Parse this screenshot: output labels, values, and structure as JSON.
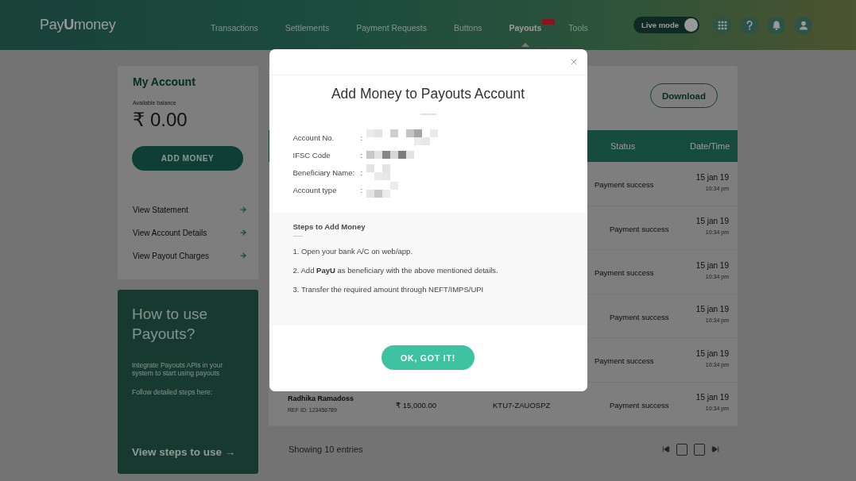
{
  "header": {
    "logo": "Pay**U**money",
    "nav": [
      {
        "label": "Transactions",
        "selected": false,
        "badge": false
      },
      {
        "label": "Settlements",
        "selected": false,
        "badge": false
      },
      {
        "label": "Payment Requests",
        "selected": false,
        "badge": false
      },
      {
        "label": "Buttons",
        "selected": false,
        "badge": false
      },
      {
        "label": "Payouts",
        "selected": true,
        "badge": true
      },
      {
        "label": "Tools",
        "selected": false,
        "badge": false
      }
    ],
    "live_mode": {
      "label": "Live mode",
      "on": true
    }
  },
  "account_card": {
    "title": "My Account",
    "balance_label": "Available balance",
    "balance": "₹ 0.00",
    "button": "ADD MONEY",
    "links": [
      "View Statement",
      "View Account Details",
      "View Payout Charges"
    ]
  },
  "help_card": {
    "title": "How to use Payouts?",
    "paragraphs": [
      "Integrate Payouts APIs in your system to start using payouts",
      "Follow detailed steps here:"
    ],
    "link": "View steps to use →"
  },
  "transactions": {
    "download": "Download",
    "columns": [
      {
        "label": "Status"
      },
      {
        "label": "Date/Time"
      }
    ],
    "rows": [
      {
        "status": "Payment success",
        "date": "15 jan 19",
        "time": "10:34 pm"
      },
      {
        "status": "Payment success",
        "date": "15 jan 19",
        "time": "10:34 pm"
      },
      {
        "status": "Payment success",
        "date": "15 jan 19",
        "time": "10:34 pm"
      },
      {
        "status": "Payment success",
        "date": "15 jan 19",
        "time": "10:34 pm"
      },
      {
        "status": "Payment success",
        "date": "15 jan 19",
        "time": "10:34 pm"
      },
      {
        "column_1": "Radhika Ramadoss",
        "column_1_sub": "REF ID: 123456789",
        "column_2": "₹ 15,000.00",
        "column_3": "KTU7-ZAUOSPZ",
        "status": "Payment success",
        "date": "15 jan 19",
        "time": "10:34 pm"
      }
    ],
    "footer": "Showing 10 entries"
  },
  "modal": {
    "title": "Add Money to Payouts Account",
    "details": [
      {
        "label": "Account No.",
        "colon": ":"
      },
      {
        "label": "IFSC Code",
        "colon": ":"
      },
      {
        "label": "Beneficiary Name:",
        "colon": ":"
      },
      {
        "label": "Account type",
        "colon": ":"
      }
    ],
    "steps": {
      "title": "Steps to Add Money",
      "items": [
        "1. Open your bank A/C on web/app.",
        "2. Add **PayU** as beneficiary with the above mentioned details.",
        "3. Transfer the required amount through NEFT/IMPS/UPI"
      ]
    },
    "button": "OK, GOT IT!"
  }
}
